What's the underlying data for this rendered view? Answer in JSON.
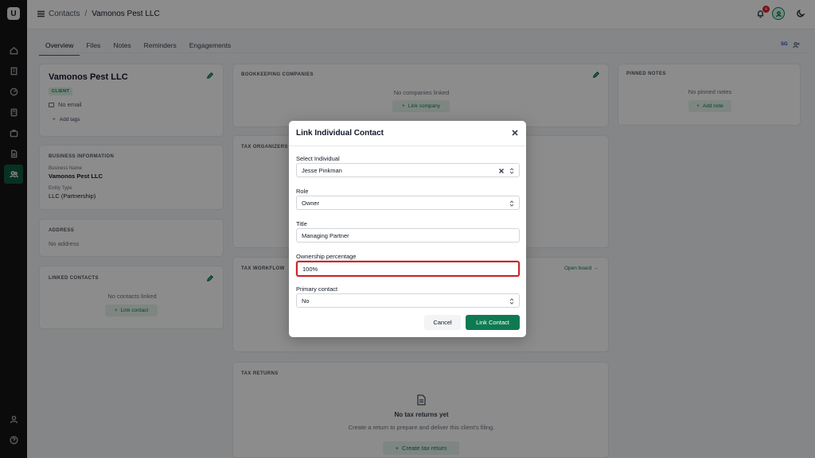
{
  "header": {
    "breadcrumb_root": "Contacts",
    "breadcrumb_sep": "/",
    "breadcrumb_current": "Vamonos Pest LLC",
    "notification_count": "4"
  },
  "tabs": [
    {
      "label": "Overview"
    },
    {
      "label": "Files"
    },
    {
      "label": "Notes"
    },
    {
      "label": "Reminders"
    },
    {
      "label": "Engagements"
    }
  ],
  "header_right": {
    "sg_label": "SG"
  },
  "profile": {
    "name": "Vamonos Pest LLC",
    "badge": "CLIENT",
    "email": "No email",
    "add_tags": "Add tags"
  },
  "business_info": {
    "heading": "BUSINESS INFORMATION",
    "business_name_label": "Business Name",
    "business_name": "Vamonos Pest LLC",
    "entity_type_label": "Entity Type",
    "entity_type": "LLC (Partnership)"
  },
  "address": {
    "heading": "ADDRESS",
    "value": "No address"
  },
  "linked_contacts": {
    "heading": "LINKED CONTACTS",
    "empty": "No contacts linked",
    "button": "Link contact"
  },
  "bookkeeping": {
    "heading": "BOOKKEEPING COMPANIES",
    "empty": "No companies linked",
    "button": "Link company"
  },
  "tax_organizers": {
    "heading": "TAX ORGANIZERS"
  },
  "tax_workflow": {
    "heading": "TAX WORKFLOW",
    "link": "Open board →"
  },
  "tax_returns": {
    "heading": "TAX RETURNS",
    "empty_title": "No tax returns yet",
    "empty_desc": "Create a return to prepare and deliver this client's filing.",
    "button": "Create tax return"
  },
  "pinned_notes": {
    "heading": "PINNED NOTES",
    "empty": "No pinned notes",
    "button": "Add note"
  },
  "modal": {
    "title": "Link Individual Contact",
    "select_individual_label": "Select Individual",
    "select_individual_value": "Jesse Pinkman",
    "role_label": "Role",
    "role_value": "Owner",
    "title_label": "Title",
    "title_value": "Managing Partner",
    "ownership_label": "Ownership percentage",
    "ownership_value": "100%",
    "primary_label": "Primary contact",
    "primary_value": "No",
    "cancel": "Cancel",
    "submit": "Link Contact"
  }
}
